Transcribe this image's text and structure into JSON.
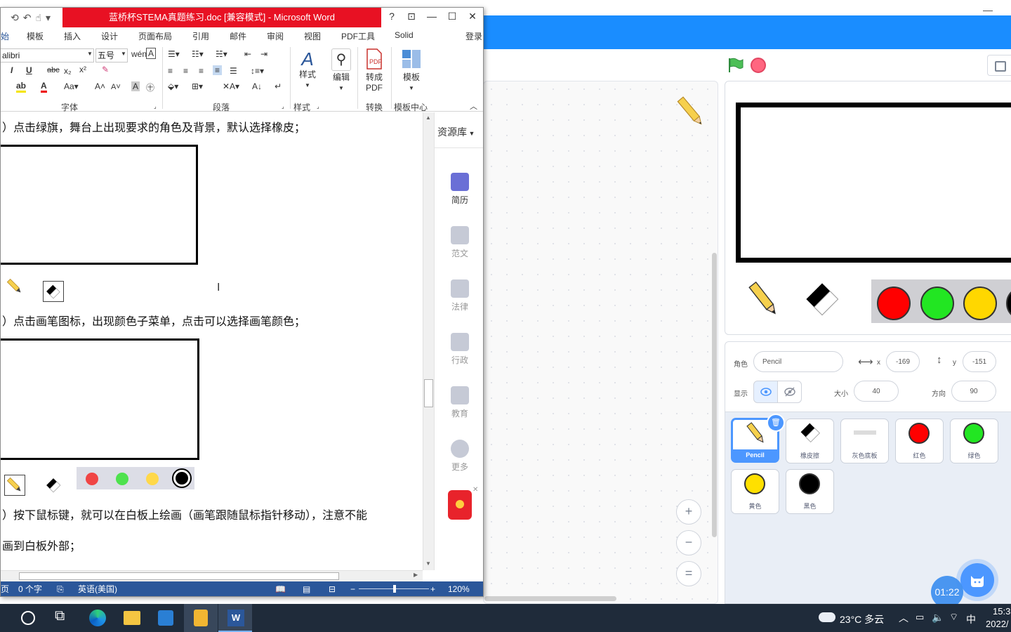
{
  "word": {
    "title": "蓝桥杯STEMA真题练习.doc [兼容模式] - Microsoft Word",
    "help_label": "?",
    "tabs": [
      {
        "label": "始",
        "active": true
      },
      {
        "label": "模板"
      },
      {
        "label": "插入"
      },
      {
        "label": "设计"
      },
      {
        "label": "页面布局"
      },
      {
        "label": "引用"
      },
      {
        "label": "邮件"
      },
      {
        "label": "审阅"
      },
      {
        "label": "视图"
      },
      {
        "label": "PDF工具"
      },
      {
        "label": "Solid"
      }
    ],
    "login_label": "登录",
    "ribbon": {
      "font_name": "alibri",
      "font_size": "五号",
      "styles_label": "样式",
      "edit_label": "编辑",
      "to_pdf_label_1": "转成",
      "to_pdf_label_2": "PDF",
      "template_label": "模板",
      "groups": {
        "font": "字体",
        "paragraph": "段落",
        "styles": "样式",
        "convert": "转换",
        "template_center": "模板中心"
      }
    },
    "document": {
      "line1": "）点击绿旗，舞台上出现要求的角色及背景，默认选择橡皮；",
      "line2": "）点击画笔图标，出现颜色子菜单，点击可以选择画笔颜色；",
      "line3": "）按下鼠标键，就可以在白板上绘画（画笔跟随鼠标指针移动），注意不能",
      "line4": "画到白板外部；"
    },
    "side_panel": {
      "header": "资源库",
      "items": [
        {
          "label": "简历"
        },
        {
          "label": "范文"
        },
        {
          "label": "法律"
        },
        {
          "label": "行政"
        },
        {
          "label": "教育"
        },
        {
          "label": "更多"
        }
      ]
    },
    "status": {
      "page": "页",
      "word_count": "0 个字",
      "language": "英语(美国)",
      "zoom": "120%"
    }
  },
  "scratch": {
    "sprite_info": {
      "sprite_label": "角色",
      "sprite_name": "Pencil",
      "x_label": "x",
      "x_value": "-169",
      "y_label": "y",
      "y_value": "-151",
      "show_label": "显示",
      "size_label": "大小",
      "size_value": "40",
      "direction_label": "方向",
      "direction_value": "90"
    },
    "sprites": [
      {
        "name": "Pencil",
        "selected": true
      },
      {
        "name": "橡皮擦"
      },
      {
        "name": "灰色底板"
      },
      {
        "name": "红色",
        "color": "#ff0000"
      },
      {
        "name": "绿色",
        "color": "#22e622"
      },
      {
        "name": "黄色",
        "color": "#ffe000"
      },
      {
        "name": "黑色",
        "color": "#000000"
      }
    ],
    "stage_palette": [
      "#ff0000",
      "#22e622",
      "#ffd700"
    ],
    "timer": "01:22"
  },
  "taskbar": {
    "weather": "23°C 多云",
    "ime": "中",
    "time": "15:3",
    "date": "2022/"
  },
  "colors": {
    "accent_blue": "#1a8dff",
    "word_blue": "#2b579a",
    "word_title_red": "#e81123",
    "scratch_select": "#4c97ff"
  }
}
